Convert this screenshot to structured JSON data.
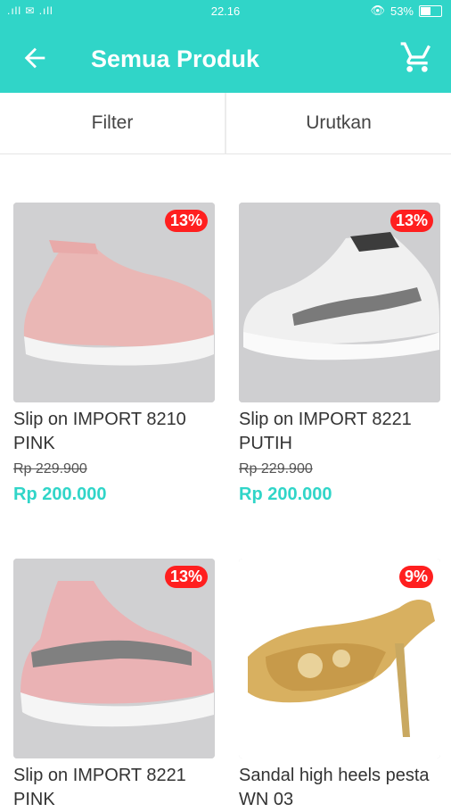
{
  "status_bar": {
    "time": "22.16",
    "signal": ".ıll ✉ .ıll",
    "battery": "53%"
  },
  "header": {
    "title": "Semua Produk",
    "back_icon": "arrow-left-icon",
    "cart_icon": "cart-icon"
  },
  "tabs": {
    "filter": "Filter",
    "sort": "Urutkan"
  },
  "products": [
    {
      "name": "Slip on IMPORT 8210 PINK",
      "old_price": "Rp 229.900",
      "price": "Rp 200.000",
      "discount": "13%"
    },
    {
      "name": "Slip on IMPORT 8221 PUTIH",
      "old_price": "Rp 229.900",
      "price": "Rp 200.000",
      "discount": "13%"
    },
    {
      "name": "Slip on IMPORT 8221 PINK",
      "old_price": "",
      "price": "",
      "discount": "13%"
    },
    {
      "name": "Sandal high heels pesta WN 03",
      "old_price": "",
      "price": "",
      "discount": "9%"
    }
  ],
  "colors": {
    "accent": "#30d5c8",
    "badge": "#ff1f1f"
  }
}
